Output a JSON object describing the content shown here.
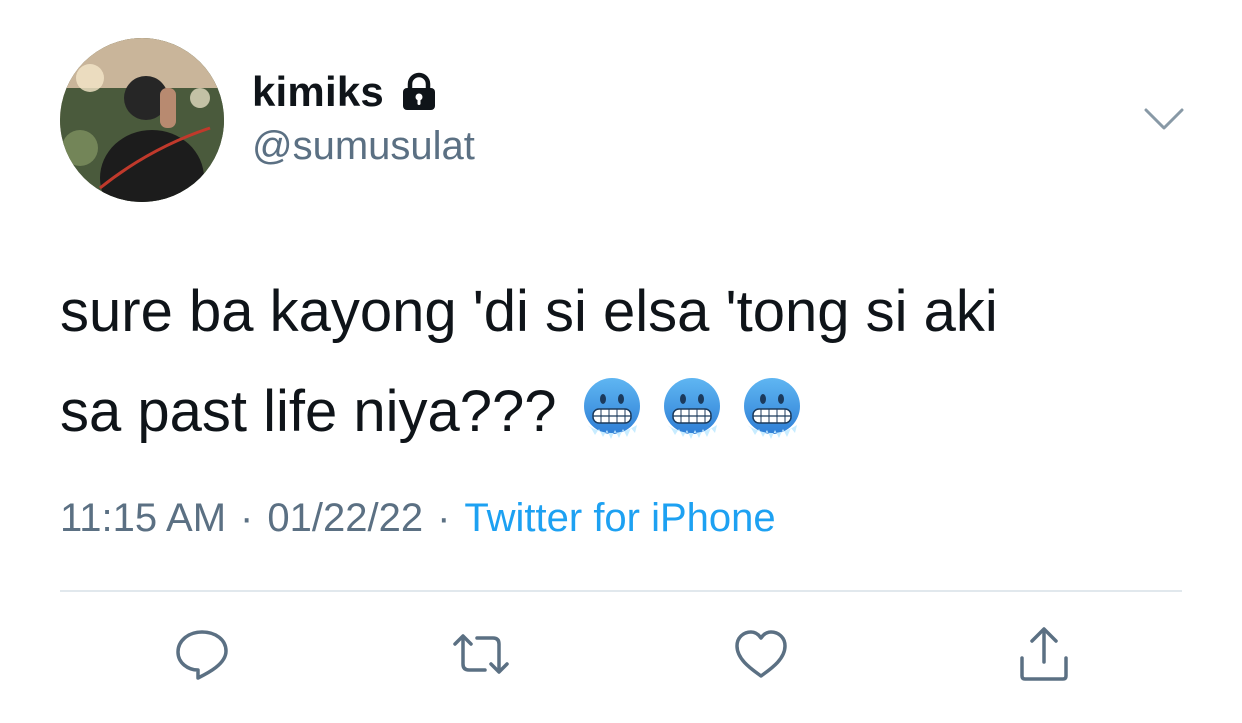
{
  "user": {
    "display_name": "kimiks",
    "handle": "@sumusulat",
    "protected_icon": "lock-icon",
    "avatar": "profile-photo"
  },
  "tweet": {
    "line1": "sure ba kayong 'di si elsa 'tong si aki",
    "line2": "sa past life niya???",
    "emojis": [
      "cold-face-emoji",
      "cold-face-emoji",
      "cold-face-emoji"
    ]
  },
  "meta": {
    "time": "11:15 AM",
    "separator": "·",
    "date": "01/22/22",
    "source": "Twitter for iPhone"
  },
  "actions": [
    "reply-icon",
    "retweet-icon",
    "like-icon",
    "share-icon"
  ],
  "menu_icon": "chevron-down-icon",
  "colors": {
    "text": "#0f1419",
    "secondary": "#5b7083",
    "link": "#1da1f2",
    "divider": "#e1e8ed"
  }
}
